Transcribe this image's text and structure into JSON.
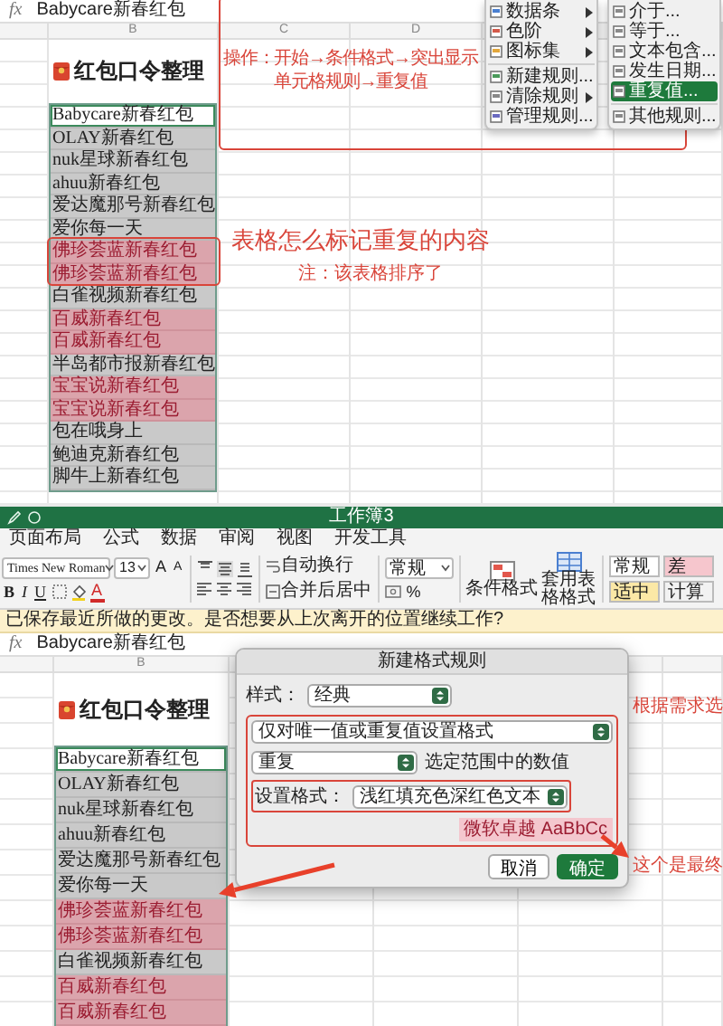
{
  "top_sheet": {
    "formula_bar": {
      "label": "fx",
      "value": "Babycare新春红包"
    },
    "column_headers": [
      "B",
      "C",
      "D"
    ],
    "title": "红包口令整理",
    "rows": [
      {
        "text": "Babycare新春红包",
        "selected": true,
        "duplicate": false
      },
      {
        "text": "OLAY新春红包",
        "selected": false,
        "duplicate": false
      },
      {
        "text": "nuk星球新春红包",
        "selected": false,
        "duplicate": false
      },
      {
        "text": "ahuu新春红包",
        "selected": false,
        "duplicate": false
      },
      {
        "text": "爱达魔那号新春红包",
        "selected": false,
        "duplicate": false
      },
      {
        "text": "爱你每一天",
        "selected": false,
        "duplicate": false
      },
      {
        "text": "佛珍荟蓝新春红包",
        "selected": false,
        "duplicate": true
      },
      {
        "text": "佛珍荟蓝新春红包",
        "selected": false,
        "duplicate": true
      },
      {
        "text": "白雀视频新春红包",
        "selected": false,
        "duplicate": false
      },
      {
        "text": "百威新春红包",
        "selected": false,
        "duplicate": true
      },
      {
        "text": "百威新春红包",
        "selected": false,
        "duplicate": true
      },
      {
        "text": "半岛都市报新春红包",
        "selected": false,
        "duplicate": false
      },
      {
        "text": "宝宝说新春红包",
        "selected": false,
        "duplicate": true
      },
      {
        "text": "宝宝说新春红包",
        "selected": false,
        "duplicate": true
      },
      {
        "text": "包在哦身上",
        "selected": false,
        "duplicate": false
      },
      {
        "text": "鲍迪克新春红包",
        "selected": false,
        "duplicate": false
      },
      {
        "text": "脚牛上新春红包",
        "selected": false,
        "duplicate": false
      }
    ],
    "instruction": [
      "操作：开始→条件格式→突出显示",
      "单元格规则→重复值"
    ],
    "heading": "表格怎么标记重复的内容",
    "note": "注：该表格排序了"
  },
  "format_menu": {
    "groups": [
      [
        {
          "label": "数据条",
          "has_submenu": true
        },
        {
          "label": "色阶",
          "has_submenu": true
        },
        {
          "label": "图标集",
          "has_submenu": true
        }
      ],
      [
        {
          "label": "新建规则...",
          "has_submenu": false
        },
        {
          "label": "清除规则",
          "has_submenu": true
        },
        {
          "label": "管理规则...",
          "has_submenu": false
        }
      ]
    ]
  },
  "highlight_submenu": {
    "groups": [
      [
        {
          "label": "介于...",
          "selected": false
        },
        {
          "label": "等于...",
          "selected": false
        },
        {
          "label": "文本包含...",
          "selected": false
        },
        {
          "label": "发生日期...",
          "selected": false
        },
        {
          "label": "重复值...",
          "selected": true
        }
      ],
      [
        {
          "label": "其他规则...",
          "selected": false
        }
      ]
    ]
  },
  "excel": {
    "window_title": "工作簿3",
    "tabs": [
      "页面布局",
      "公式",
      "数据",
      "审阅",
      "视图",
      "开发工具"
    ],
    "ribbon": {
      "font_name": "Times New Roman",
      "font_size": "13",
      "font_size_buttons": [
        "A",
        "A"
      ],
      "style_buttons": [
        "B",
        "I",
        "U"
      ],
      "font_color_button": "A",
      "wrap_text": "自动换行",
      "merge_center": "合并后居中",
      "number_format": "常规",
      "percent_button": "%",
      "conditional_format": "条件格式",
      "table_format": "套用表格格式",
      "cell_styles": [
        {
          "label": "常规",
          "color": "#ffffff"
        },
        {
          "label": "差",
          "color": "#f6c6cd"
        },
        {
          "label": "适中",
          "color": "#fbe8a6"
        },
        {
          "label": "计算",
          "color": "#f2f2f2"
        }
      ]
    },
    "info_bar": "已保存最近所做的更改。是否想要从上次离开的位置继续工作?",
    "formula_bar": {
      "label": "fx",
      "value": "Babycare新春红包"
    },
    "sheet": {
      "column_headers": [
        "B"
      ],
      "title": "红包口令整理",
      "rows": [
        {
          "text": "Babycare新春红包",
          "selected": true,
          "duplicate": false
        },
        {
          "text": "OLAY新春红包",
          "selected": false,
          "duplicate": false
        },
        {
          "text": "nuk星球新春红包",
          "selected": false,
          "duplicate": false
        },
        {
          "text": "ahuu新春红包",
          "selected": false,
          "duplicate": false
        },
        {
          "text": "爱达魔那号新春红包",
          "selected": false,
          "duplicate": false
        },
        {
          "text": "爱你每一天",
          "selected": false,
          "duplicate": false
        },
        {
          "text": "佛珍荟蓝新春红包",
          "selected": false,
          "duplicate": true
        },
        {
          "text": "佛珍荟蓝新春红包",
          "selected": false,
          "duplicate": true
        },
        {
          "text": "白雀视频新春红包",
          "selected": false,
          "duplicate": false
        },
        {
          "text": "百威新春红包",
          "selected": false,
          "duplicate": true
        },
        {
          "text": "百威新春红包",
          "selected": false,
          "duplicate": true
        }
      ]
    }
  },
  "dialog": {
    "title": "新建格式规则",
    "style_label": "样式：",
    "style_value": "经典",
    "rule_type": "仅对唯一值或重复值设置格式",
    "match": "重复",
    "match_hint": "选定范围中的数值",
    "format_label": "设置格式：",
    "format_value": "浅红填充色深红色文本",
    "preview": "微软卓越 AaBbCc",
    "buttons": [
      {
        "label": "取消",
        "primary": false
      },
      {
        "label": "确定",
        "primary": true
      }
    ]
  },
  "annotations": [
    "根据需求选",
    "这个是最终"
  ]
}
